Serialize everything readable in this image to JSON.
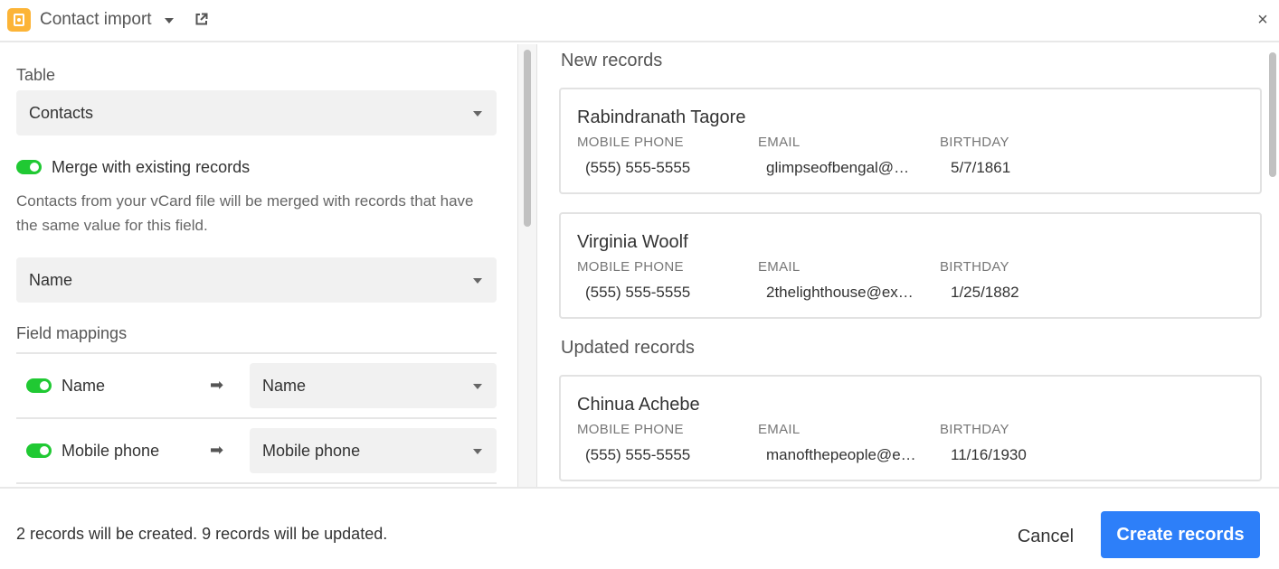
{
  "header": {
    "title": "Contact import",
    "app_icon": "contact-card-icon",
    "accent_color": "#fcb437",
    "close_glyph": "×"
  },
  "left": {
    "table_label": "Table",
    "table_value": "Contacts",
    "merge_toggle_on": true,
    "merge_label": "Merge with existing records",
    "merge_help": "Contacts from your vCard file will be merged with records that have the same value for this field.",
    "merge_field_value": "Name",
    "field_mappings_label": "Field mappings",
    "mappings": [
      {
        "enabled": true,
        "source": "Name",
        "target": "Name"
      },
      {
        "enabled": true,
        "source": "Mobile phone",
        "target": "Mobile phone"
      }
    ],
    "toggle_color": "#20c933"
  },
  "right": {
    "new_records_title": "New records",
    "updated_records_title": "Updated records",
    "columns": {
      "phone": "MOBILE PHONE",
      "email": "EMAIL",
      "birthday": "BIRTHDAY"
    },
    "new_records": [
      {
        "name": "Rabindranath Tagore",
        "phone": "(555) 555-5555",
        "email": "glimpseofbengal@…",
        "birthday": "5/7/1861"
      },
      {
        "name": "Virginia Woolf",
        "phone": "(555) 555-5555",
        "email": "2thelighthouse@ex…",
        "birthday": "1/25/1882"
      }
    ],
    "updated_records": [
      {
        "name": "Chinua Achebe",
        "phone": "(555) 555-5555",
        "email": "manofthepeople@e…",
        "birthday": "11/16/1930"
      }
    ]
  },
  "footer": {
    "status": "2 records will be created. 9 records will be updated.",
    "cancel_label": "Cancel",
    "create_label": "Create records",
    "primary_color": "#2d7ff9"
  }
}
